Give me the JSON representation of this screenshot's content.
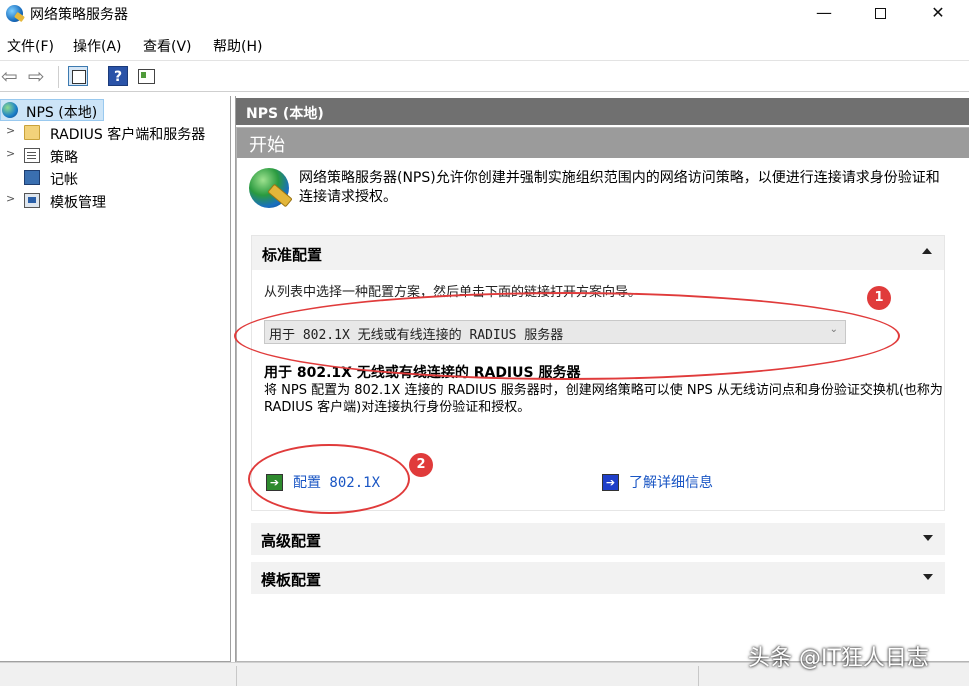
{
  "window": {
    "title": "网络策略服务器",
    "min_glyph": "—",
    "close_glyph": "✕"
  },
  "menu": [
    "文件(F)",
    "操作(A)",
    "查看(V)",
    "帮助(H)"
  ],
  "toolbar": {
    "back_glyph": "⇦",
    "forward_glyph": "⇨",
    "help_glyph": "?"
  },
  "tree": {
    "root": "NPS (本地)",
    "items": [
      {
        "label": "RADIUS 客户端和服务器",
        "icon": "folder-icon",
        "expandable": true
      },
      {
        "label": "策略",
        "icon": "policy-icon",
        "expandable": true
      },
      {
        "label": "记帐",
        "icon": "accounting-icon",
        "expandable": false
      },
      {
        "label": "模板管理",
        "icon": "template-icon",
        "expandable": true
      }
    ]
  },
  "content": {
    "header": "NPS (本地)",
    "start_title": "开始",
    "intro": "网络策略服务器(NPS)允许你创建并强制实施组织范围内的网络访问策略，以便进行连接请求身份验证和连接请求授权。",
    "standard": {
      "title": "标准配置",
      "description": "从列表中选择一种配置方案，然后单击下面的链接打开方案向导。",
      "selected_option": "用于 802.1X 无线或有线连接的 RADIUS 服务器",
      "option_title": "用于 802.1X 无线或有线连接的 RADIUS 服务器",
      "option_desc": "将 NPS 配置为 802.1X 连接的 RADIUS 服务器时，创建网络策略可以使 NPS 从无线访问点和身份验证交换机(也称为 RADIUS 客户端)对连接执行身份验证和授权。",
      "configure_link": "配置 802.1X",
      "learn_more_link": "了解详细信息"
    },
    "advanced_title": "高级配置",
    "template_title": "模板配置"
  },
  "annotations": {
    "badge_1": "1",
    "badge_2": "2",
    "color": "#e03b3b"
  },
  "watermark": "头条 @IT狂人日志"
}
